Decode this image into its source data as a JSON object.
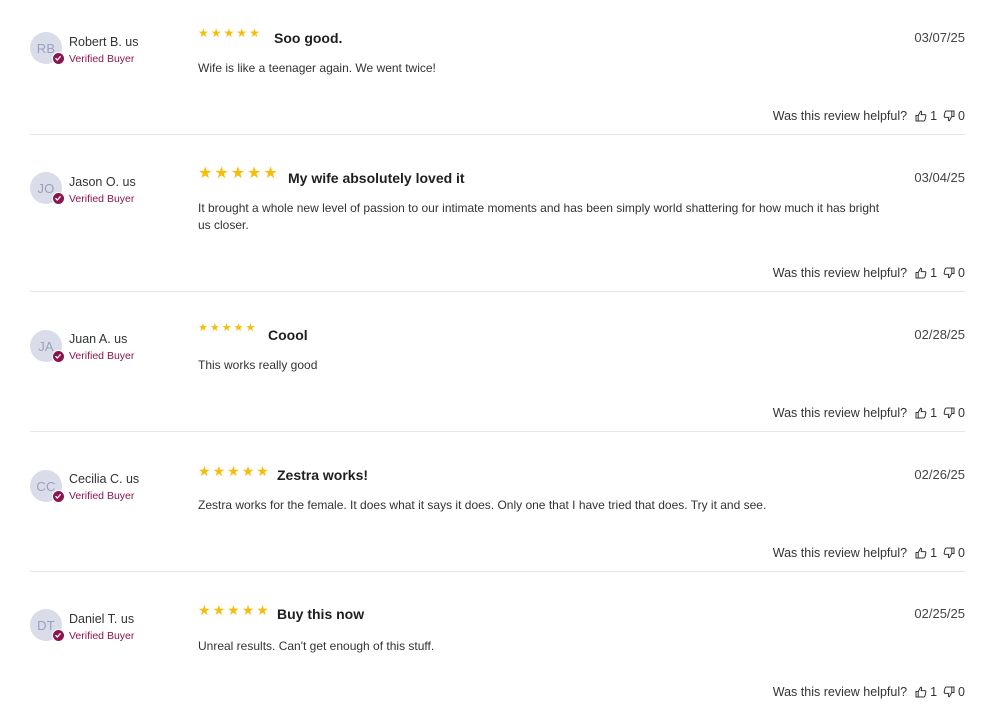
{
  "helpful_prompt": "Was this review helpful?",
  "colors": {
    "star": "#f5bd0c",
    "verified": "#8a1650",
    "avatar_bg": "#d9dce9",
    "avatar_text": "#9aa0bd",
    "divider": "#e6e6e6"
  },
  "reviews": [
    {
      "initials": "RB",
      "author": "Robert B. us",
      "verified_label": "Verified Buyer",
      "rating": 5,
      "title": "Soo good.",
      "date": "03/07/25",
      "body": "Wife is like a teenager again. We went twice!",
      "helpful_yes": "1",
      "helpful_no": "0"
    },
    {
      "initials": "JO",
      "author": "Jason O. us",
      "verified_label": "Verified Buyer",
      "rating": 5,
      "title": "My wife absolutely loved it",
      "date": "03/04/25",
      "body": "It brought a whole new level of passion to our intimate moments and has been simply world shattering for how much it has bright us closer.",
      "helpful_yes": "1",
      "helpful_no": "0"
    },
    {
      "initials": "JA",
      "author": "Juan A. us",
      "verified_label": "Verified Buyer",
      "rating": 5,
      "title": "Coool",
      "date": "02/28/25",
      "body": "This works really good",
      "helpful_yes": "1",
      "helpful_no": "0"
    },
    {
      "initials": "CC",
      "author": "Cecilia C. us",
      "verified_label": "Verified Buyer",
      "rating": 5,
      "title": "Zestra works!",
      "date": "02/26/25",
      "body": "Zestra works for the female. It does what it says it does. Only one that I have tried that does. Try it and see.",
      "helpful_yes": "1",
      "helpful_no": "0"
    },
    {
      "initials": "DT",
      "author": "Daniel T. us",
      "verified_label": "Verified Buyer",
      "rating": 5,
      "title": "Buy this now",
      "date": "02/25/25",
      "body": "Unreal results. Can't get enough of this stuff.",
      "helpful_yes": "1",
      "helpful_no": "0"
    }
  ]
}
